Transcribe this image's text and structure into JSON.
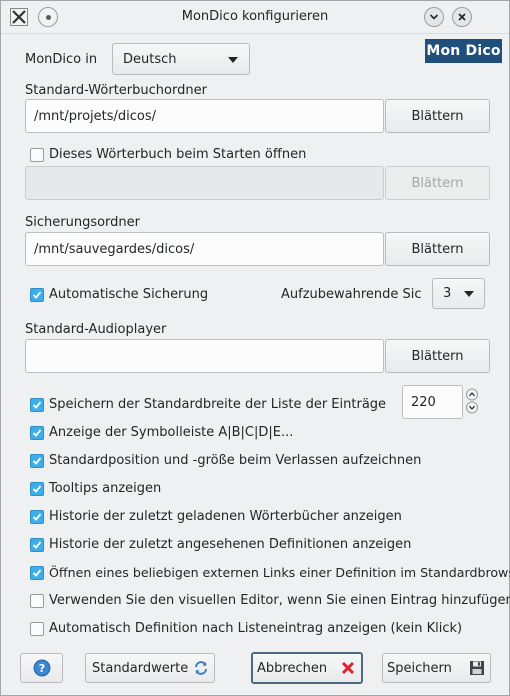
{
  "window": {
    "title": "MonDico konfigurieren"
  },
  "logo": {
    "text": "Mon Dico"
  },
  "language": {
    "label": "MonDico in",
    "value": "Deutsch"
  },
  "dict_folder": {
    "label": "Standard-Wörterbuchordner",
    "path": "/mnt/projets/dicos/",
    "browse_label": "Blättern"
  },
  "open_on_start": {
    "label": "Dieses Wörterbuch beim Starten öffnen",
    "checked": false,
    "path": "",
    "browse_label": "Blättern"
  },
  "backup_folder": {
    "label": "Sicherungsordner",
    "path": "/mnt/sauvegardes/dicos/",
    "browse_label": "Blättern"
  },
  "auto_backup": {
    "label": "Automatische Sicherung",
    "checked": true,
    "keep_label": "Aufzubewahrende Sich",
    "keep_value": "3"
  },
  "audio_player": {
    "label": "Standard-Audioplayer",
    "path": "",
    "browse_label": "Blättern"
  },
  "options": [
    {
      "label": "Speichern der Standardbreite der Liste der Einträge",
      "checked": true
    },
    {
      "label": "Anzeige der Symbolleiste A|B|C|D|E...",
      "checked": true
    },
    {
      "label": "Standardposition und -größe beim Verlassen aufzeichnen",
      "checked": true
    },
    {
      "label": "Tooltips anzeigen",
      "checked": true
    },
    {
      "label": "Historie der zuletzt geladenen Wörterbücher anzeigen",
      "checked": true
    },
    {
      "label": "Historie der zuletzt angesehenen Definitionen anzeigen",
      "checked": true
    },
    {
      "label": "Öffnen eines beliebigen externen Links einer Definition im Standardbrowser",
      "checked": true
    },
    {
      "label": "Verwenden Sie den visuellen Editor, wenn Sie einen Eintrag hinzufügen",
      "checked": false
    },
    {
      "label": "Automatisch Definition nach Listeneintrag anzeigen (kein Klick)",
      "checked": false
    }
  ],
  "list_width": {
    "value": "220"
  },
  "footer": {
    "defaults_label": "Standardwerte",
    "cancel_label": "Abbrechen",
    "save_label": "Speichern"
  },
  "colors": {
    "accent": "#3daee9",
    "logo_bg": "#1f4f7a",
    "cancel_x": "#e0202a"
  },
  "icons": {
    "app": "x-app-icon",
    "help": "help-icon",
    "refresh": "refresh-icon",
    "cancel": "cancel-x-icon",
    "save": "floppy-save-icon"
  }
}
